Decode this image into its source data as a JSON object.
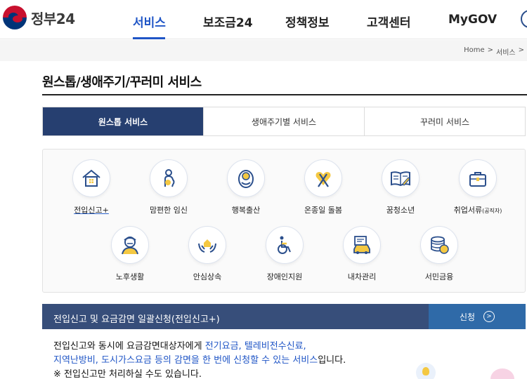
{
  "header": {
    "logo_text": "정부24",
    "nav": [
      "서비스",
      "보조금24",
      "정책정보",
      "고객센터",
      "MyGOV"
    ]
  },
  "breadcrumb": [
    "Home",
    ">",
    "서비스",
    ">"
  ],
  "page_title": "원스톱/생애주기/꾸러미 서비스",
  "tabs": [
    "원스톱 서비스",
    "생애주기별 서비스",
    "꾸러미 서비스"
  ],
  "services": [
    {
      "label": "전입신고+",
      "icon": "house-icon"
    },
    {
      "label": "맘편한 임신",
      "icon": "pregnancy-icon"
    },
    {
      "label": "행복출산",
      "icon": "baby-icon"
    },
    {
      "label": "온종일 돌봄",
      "icon": "care-ribbon-icon"
    },
    {
      "label": "꿈청소년",
      "icon": "book-icon"
    },
    {
      "label": "취업서류",
      "icon": "briefcase-icon",
      "suffix": "(공직자)"
    },
    {
      "label": "노후생활",
      "icon": "elder-icon"
    },
    {
      "label": "안심상속",
      "icon": "hands-house-icon"
    },
    {
      "label": "장애인지원",
      "icon": "wheelchair-icon"
    },
    {
      "label": "내차관리",
      "icon": "car-icon"
    },
    {
      "label": "서민금융",
      "icon": "coins-icon"
    }
  ],
  "banner": {
    "title": "전입신고 및 요금감면 일괄신청(전입신고+)",
    "button": "신청",
    "desc_line1_a": "전입신고와 동시에 요금감면대상자에게 ",
    "desc_line1_b": "전기요금, 텔레비전수신료,",
    "desc_line2_a": "지역난방비, 도시가스요금 등의 감면을 한 번에 신청할 수 있는 서비스",
    "desc_line2_b": "입니다.",
    "desc_line3": "※ 전입신고만 처리하실 수도 있습니다."
  },
  "colors": {
    "accent": "#1f55c6",
    "tab_active": "#263f70",
    "banner": "#374e7a",
    "banner_button": "#2f6aa8",
    "icon_blue": "#2b4f8c",
    "icon_yellow": "#f4c842"
  }
}
